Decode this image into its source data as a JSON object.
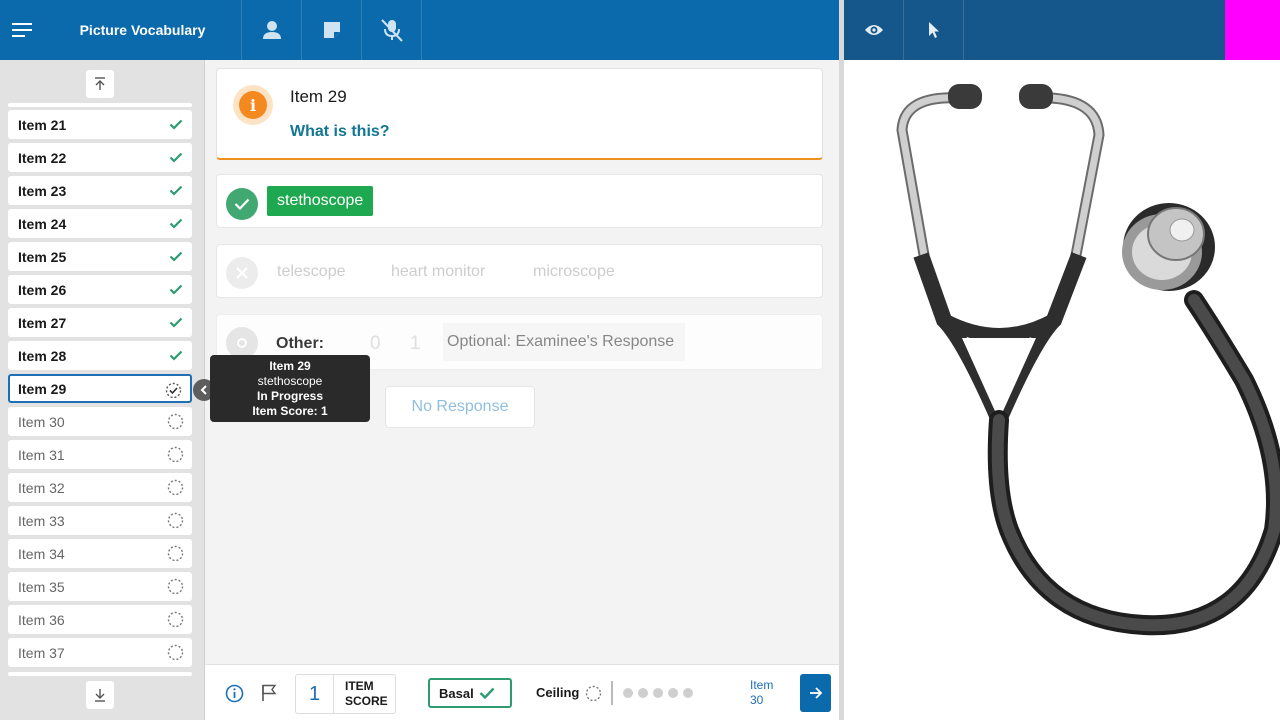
{
  "header": {
    "title": "Picture Vocabulary",
    "icons": [
      "menu-icon",
      "examinee-icon",
      "notes-icon",
      "mic-muted-icon"
    ]
  },
  "stimulus_toolbar": {
    "icons": [
      "eye-icon",
      "pointer-icon"
    ],
    "accent": "#ff00ff"
  },
  "sidebar": {
    "items": [
      {
        "label": "Item 21",
        "status": "done"
      },
      {
        "label": "Item 22",
        "status": "done"
      },
      {
        "label": "Item 23",
        "status": "done"
      },
      {
        "label": "Item 24",
        "status": "done"
      },
      {
        "label": "Item 25",
        "status": "done"
      },
      {
        "label": "Item 26",
        "status": "done"
      },
      {
        "label": "Item 27",
        "status": "done"
      },
      {
        "label": "Item 28",
        "status": "done"
      },
      {
        "label": "Item 29",
        "status": "current"
      },
      {
        "label": "Item 30",
        "status": "pending"
      },
      {
        "label": "Item 31",
        "status": "pending"
      },
      {
        "label": "Item 32",
        "status": "pending"
      },
      {
        "label": "Item 33",
        "status": "pending"
      },
      {
        "label": "Item 34",
        "status": "pending"
      },
      {
        "label": "Item 35",
        "status": "pending"
      },
      {
        "label": "Item 36",
        "status": "pending"
      },
      {
        "label": "Item 37",
        "status": "pending"
      }
    ]
  },
  "question": {
    "item": "Item 29",
    "prompt": "What is this?"
  },
  "answers": {
    "correct": "stethoscope",
    "incorrect": [
      "telescope",
      "heart monitor",
      "microscope"
    ],
    "other_label": "Other:",
    "score_options": [
      "0",
      "1"
    ],
    "response_placeholder": "Optional: Examinee's Response",
    "no_response": "No Response"
  },
  "tooltip": {
    "item": "Item 29",
    "answer": "stethoscope",
    "status": "In Progress",
    "score": "Item Score: 1"
  },
  "footer": {
    "score_value": "1",
    "score_label_1": "ITEM",
    "score_label_2": "SCORE",
    "basal": "Basal",
    "ceiling": "Ceiling",
    "next_label_1": "Item",
    "next_label_2": "30"
  },
  "colors": {
    "primary": "#0b6aab",
    "correct": "#1ea84f",
    "info": "#f48a1f",
    "prompt": "#127792"
  },
  "stimulus": {
    "image": "stethoscope-illustration"
  }
}
